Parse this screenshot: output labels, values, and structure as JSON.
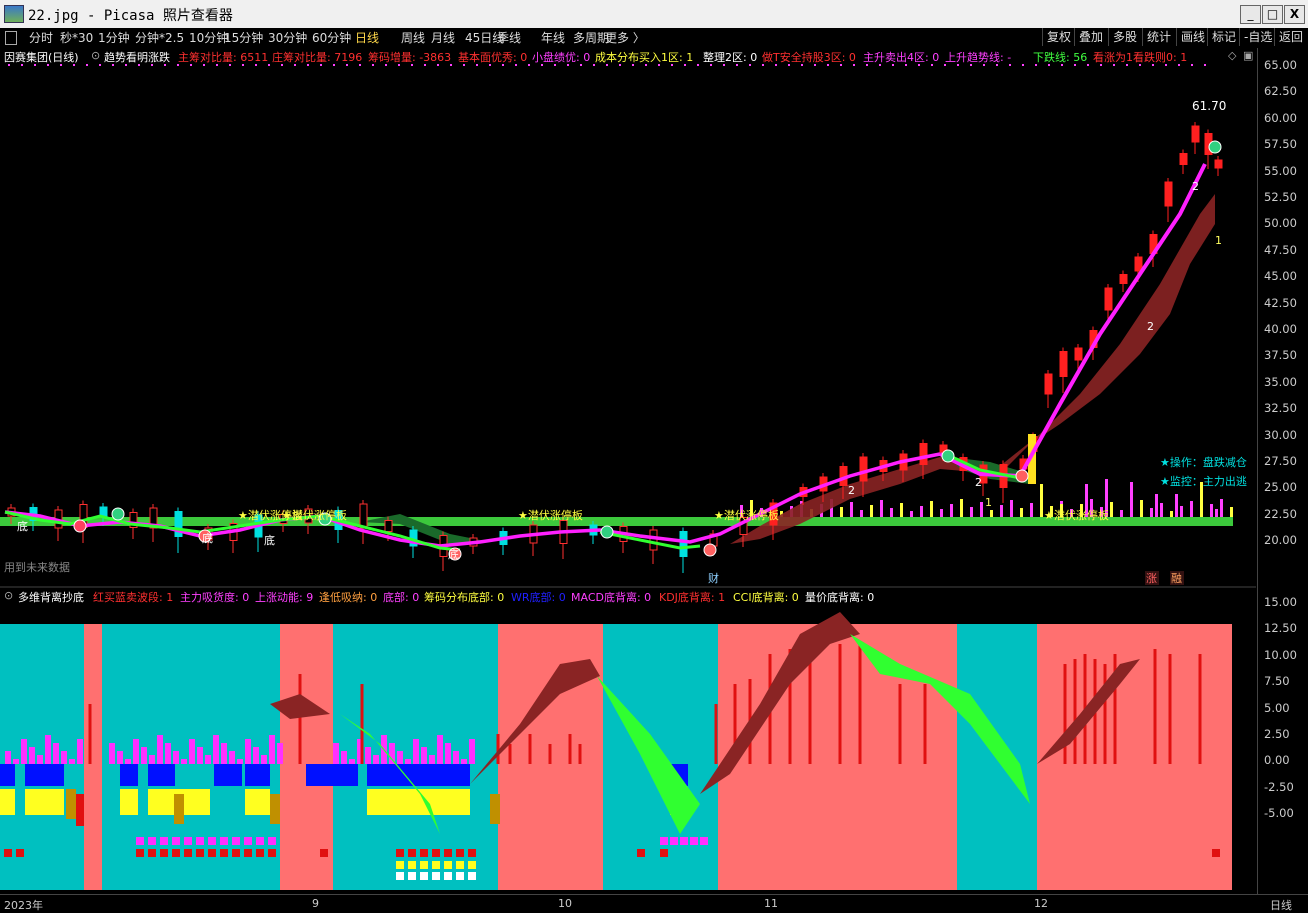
{
  "window": {
    "title": "22.jpg - Picasa 照片查看器",
    "minimize": "_",
    "maximize": "□",
    "close": "X"
  },
  "toolbar": {
    "periods": [
      "分时",
      "秒*30",
      "1分钟",
      "分钟*2.5",
      "10分钟",
      "15分钟",
      "30分钟",
      "60分钟",
      "日线",
      "周线",
      "月线",
      "45日线",
      "季线",
      "年线",
      "多周期",
      "更多 〉"
    ],
    "active_period": "日线",
    "right_buttons": [
      "复权",
      "叠加",
      "多股",
      "统计",
      "画线",
      "标记",
      "-自选",
      "返回"
    ]
  },
  "main_indicator": {
    "stock": "因赛集团(日线)",
    "name": "趋势看明涨跌",
    "items": [
      {
        "text": "主筹对比量: 6511",
        "color": "#ff3030"
      },
      {
        "text": "庄筹对比量: 7196",
        "color": "#ff3030"
      },
      {
        "text": "筹码增量: -3863",
        "color": "#ff3030"
      },
      {
        "text": "基本面优秀: 0",
        "color": "#ff3030"
      },
      {
        "text": "小盘绩优: 0",
        "color": "#ff40ff"
      },
      {
        "text": "成本分布买入1区: 1",
        "color": "#ffff40"
      },
      {
        "text": "整理2区: 0",
        "color": "#ffffff"
      },
      {
        "text": "做T安全持股3区: 0",
        "color": "#ff3030"
      },
      {
        "text": "主升卖出4区: 0",
        "color": "#ff40ff"
      },
      {
        "text": "上升趋势线: -",
        "color": "#ff40ff"
      },
      {
        "text": "下跌线: 56",
        "color": "#40ff40"
      },
      {
        "text": "看涨为1看跌则0: 1",
        "color": "#ff3030"
      }
    ]
  },
  "main_axis": [
    "65.00",
    "62.50",
    "60.00",
    "57.50",
    "55.00",
    "52.50",
    "50.00",
    "47.50",
    "45.00",
    "42.50",
    "40.00",
    "37.50",
    "35.00",
    "32.50",
    "30.00",
    "27.50",
    "25.00",
    "22.50",
    "20.00"
  ],
  "chart_labels": {
    "peak": "61.70",
    "future_data": "用到未来数据",
    "op_hint": "★操作：盘跌减仓",
    "watch_hint": "★监控：主力出逃",
    "limit_up": [
      "★潜伏涨停板",
      "★潜伏涨停板",
      "★潜伏涨停板",
      "★潜伏涨停板",
      "★潜伏涨停板"
    ],
    "bottom_markers": [
      "底",
      "底",
      "底",
      "底"
    ],
    "caibiao": "财",
    "zhang": "涨",
    "rong": "融"
  },
  "sub_indicator": {
    "name": "多维背离抄底",
    "items": [
      {
        "text": "红买蓝卖波段: 1",
        "color": "#ff3030"
      },
      {
        "text": "主力吸货度: 0",
        "color": "#ff40ff"
      },
      {
        "text": "上涨动能: 9",
        "color": "#ff40ff"
      },
      {
        "text": "逢低吸纳: 0",
        "color": "#ffa040"
      },
      {
        "text": "底部: 0",
        "color": "#ff40ff"
      },
      {
        "text": "筹码分布底部: 0",
        "color": "#ffff40"
      },
      {
        "text": "WR底部: 0",
        "color": "#2020ff"
      },
      {
        "text": "MACD底背离: 0",
        "color": "#ff40ff"
      },
      {
        "text": "KDJ底背离: 1",
        "color": "#ff3030"
      },
      {
        "text": "CCI底背离: 0",
        "color": "#ffff40"
      },
      {
        "text": "量价底背离: 0",
        "color": "#ffffff"
      }
    ]
  },
  "sub_axis": [
    "15.00",
    "12.50",
    "10.00",
    "7.50",
    "5.00",
    "2.50",
    "0.00",
    "-2.50",
    "-5.00"
  ],
  "x_axis": {
    "labels": [
      "2023年",
      "9",
      "10",
      "11",
      "12"
    ],
    "period": "日线"
  },
  "colors": {
    "up": "#ff2020",
    "down": "#00ffff",
    "ma_pink": "#ff20ff",
    "ma_green": "#30ff30",
    "band_red": "#ff7070",
    "band_cyan": "#00c0c0"
  }
}
